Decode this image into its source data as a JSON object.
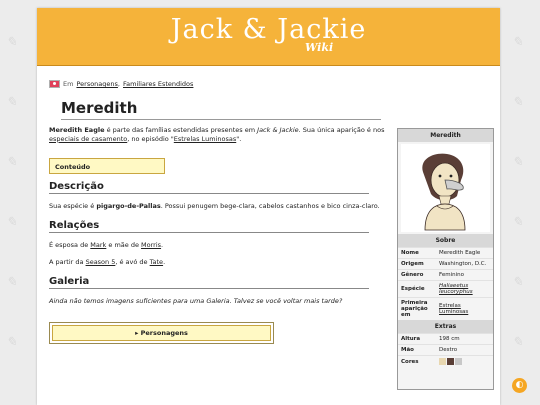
{
  "site": {
    "logo": "Jack & Jackie",
    "logo_sub": "Wiki"
  },
  "breadcrumb": {
    "prefix": "Em",
    "cat1": "Personagens",
    "cat2": "Familiares Estendidos"
  },
  "page": {
    "title": "Meredith"
  },
  "intro": {
    "name": "Meredith Eagle",
    "text1": " é parte das famílias estendidas presentes em ",
    "show": "Jack & Jackie",
    "text2": ". Sua única aparição é nos ",
    "link1": "especiais de casamento",
    "text3": ", no episódio \"",
    "link2": "Estrelas Luminosas",
    "text4": "\"."
  },
  "toc": {
    "label": "Conteúdo"
  },
  "descricao": {
    "heading": "Descrição",
    "pre": "Sua espécie é ",
    "species": "pigargo-de-Pallas",
    "post": ". Possui penugem bege-clara, cabelos castanhos e bico cinza-claro."
  },
  "relacoes": {
    "heading": "Relações",
    "p1_pre": "É esposa de ",
    "p1_link1": "Mark",
    "p1_mid": " e mãe de ",
    "p1_link2": "Morris",
    "p1_post": ".",
    "p2_pre": "A partir da ",
    "p2_link1": "Season 5",
    "p2_mid": ", é avó de ",
    "p2_link2": "Tate",
    "p2_post": "."
  },
  "galeria": {
    "heading": "Galeria",
    "text": "Ainda não temos imagens suficientes para uma Galeria. Talvez se você voltar mais tarde?"
  },
  "nav": {
    "label": "▸ Personagens"
  },
  "infobox": {
    "title": "Meredith",
    "section_sobre": "Sobre",
    "rows": [
      {
        "k": "Nome",
        "v": "Meredith Eagle"
      },
      {
        "k": "Origem",
        "v": "Washington, D.C."
      },
      {
        "k": "Gênero",
        "v": "Feminino"
      },
      {
        "k": "Espécie",
        "v": "Haliaeetus leucoryphus"
      },
      {
        "k": "Primeira aparição em",
        "v": "Estrelas Luminosas"
      }
    ],
    "section_extras": "Extras",
    "extras": [
      {
        "k": "Altura",
        "v": "198 cm"
      },
      {
        "k": "Mão",
        "v": "Destro"
      }
    ],
    "cores_label": "Cores",
    "cores": [
      "#e8d7b0",
      "#5a3e36",
      "#c8c8c8"
    ]
  }
}
